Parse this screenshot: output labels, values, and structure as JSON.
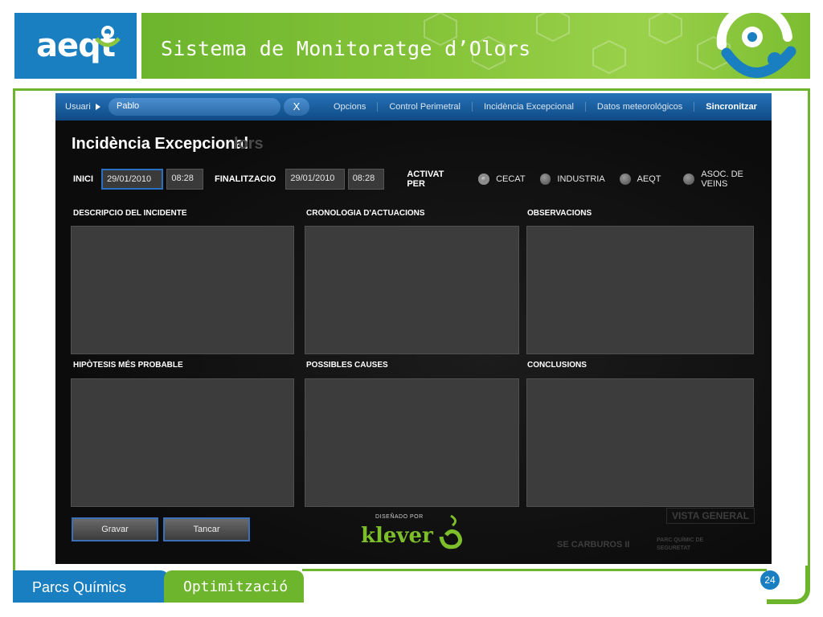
{
  "header": {
    "logo_text": "aeqt",
    "title": "Sistema de Monitoratge d’Olors"
  },
  "app": {
    "topbar": {
      "user_label": "Usuari",
      "user_value": "Pablo",
      "close_label": "X",
      "menu": [
        "Opcions",
        "Control Perimetral",
        "Incidència Excepcional",
        "Datos meteorológicos",
        "Sincronitzar"
      ]
    },
    "page_heading": "Incidència Excepcional",
    "page_heading_ghost": "lors",
    "filters": {
      "inici_label": "INICI",
      "inici_date": "29/01/2010",
      "inici_time": "08:28",
      "final_label": "FINALITZACIO",
      "final_date": "29/01/2010",
      "final_time": "08:28",
      "activat_label": "ACTIVAT PER",
      "options": [
        {
          "label": "CECAT",
          "selected": true
        },
        {
          "label": "INDUSTRIA",
          "selected": false
        },
        {
          "label": "AEQT",
          "selected": false
        },
        {
          "label": "ASOC. DE VEINS",
          "selected": false
        }
      ]
    },
    "sections": [
      "DESCRIPCIO DEL  INCIDENTE",
      "CRONOLOGIA D'ACTUACIONS",
      "OBSERVACIONS",
      "HIPÒTESIS MÉS PROBABLE",
      "POSSIBLES CAUSES",
      "CONCLUSIONS"
    ],
    "buttons": {
      "save": "Gravar",
      "close": "Tancar"
    },
    "footer": {
      "designed_by": "DISEÑADO POR",
      "brand": "klever",
      "ghost_vista": "VISTA GENERAL",
      "ghost_carburos": "SE CARBUROS II",
      "ghost_parc": "PARC QUÍMIC DE SEGURETAT"
    }
  },
  "bottom": {
    "tab1": "Parcs Químics",
    "tab2": "Optimització",
    "page_number": "24"
  },
  "colors": {
    "brand_blue": "#1a7fc1",
    "brand_green": "#6cb52d",
    "app_dark": "#0d0d0d",
    "panel": "#3c3c3c"
  }
}
